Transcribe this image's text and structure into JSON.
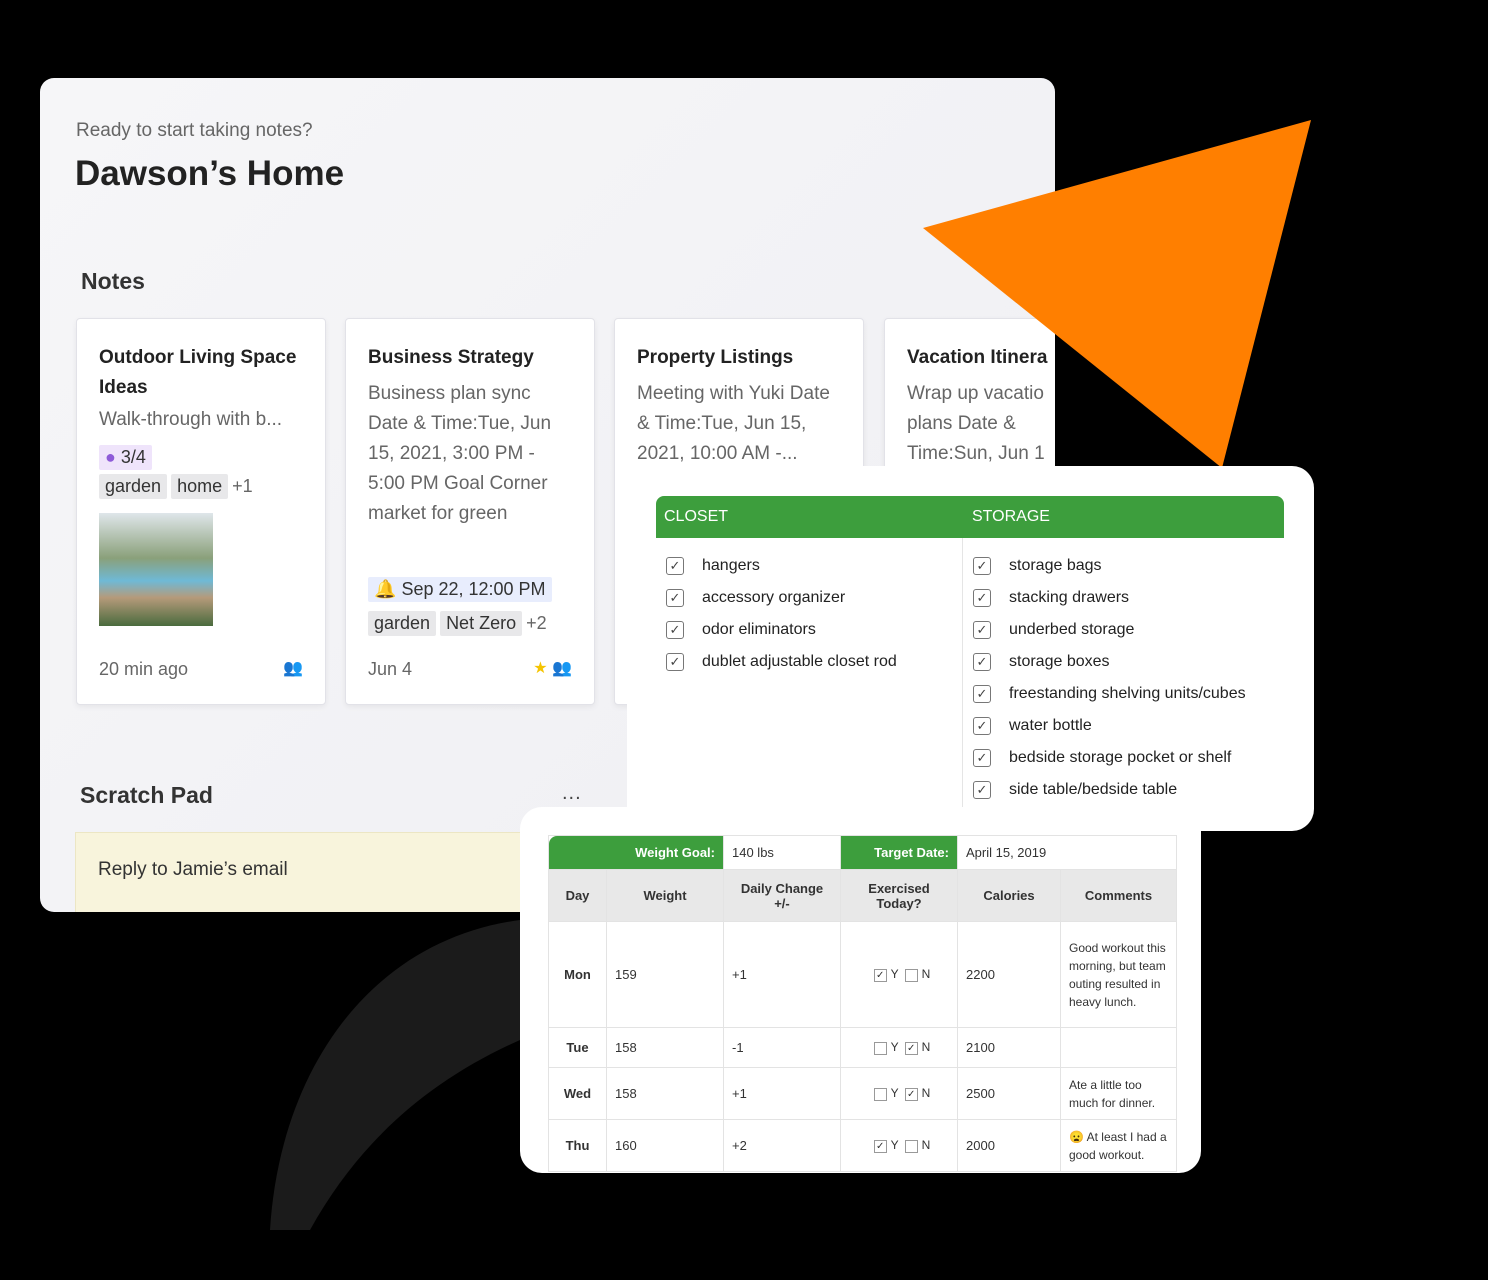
{
  "header": {
    "subtitle": "Ready to start taking notes?",
    "title": "Dawson’s Home"
  },
  "notes": {
    "heading": "Notes",
    "cards": [
      {
        "title": "Outdoor Living Space Ideas",
        "body": "Walk-through with b...",
        "task_progress": "3/4",
        "tags": [
          "garden",
          "home"
        ],
        "more_tags": "+1",
        "footer": "20 min ago"
      },
      {
        "title": "Business Strategy",
        "body": "Business plan sync Date & Time:Tue, Jun 15, 2021, 3:00 PM - 5:00 PM Goal Corner market for green",
        "reminder": "Sep 22, 12:00 PM",
        "tags": [
          "garden",
          "Net Zero"
        ],
        "more_tags": "+2",
        "footer": "Jun 4"
      },
      {
        "title": "Property Listings",
        "body": "Meeting with Yuki Date & Time:Tue, Jun 15, 2021, 10:00 AM -..."
      },
      {
        "title": "Vacation Itinera",
        "body": "Wrap up vacatio plans Date & Time:Sun, Jun 1"
      }
    ]
  },
  "scratch": {
    "heading": "Scratch Pad",
    "menu": "...",
    "text": "Reply to Jamie’s email"
  },
  "checklist": {
    "columns": [
      {
        "title": "CLOSET",
        "items": [
          "hangers",
          "accessory organizer",
          "odor eliminators",
          "dublet adjustable closet rod"
        ]
      },
      {
        "title": "STORAGE",
        "items": [
          "storage bags",
          "stacking drawers",
          "underbed storage",
          "storage boxes",
          "freestanding shelving units/cubes",
          "water bottle",
          "bedside storage pocket or shelf",
          "side table/bedside table"
        ]
      }
    ]
  },
  "tracker": {
    "goal_label": "Weight Goal:",
    "goal_value": "140 lbs",
    "date_label": "Target Date:",
    "date_value": "April 15, 2019",
    "headers": [
      "Day",
      "Weight",
      "Daily Change +/-",
      "Exercised Today?",
      "Calories",
      "Comments"
    ],
    "yes": "Y",
    "no": "N",
    "rows": [
      {
        "day": "Mon",
        "weight": "159",
        "change": "+1",
        "exercised": true,
        "calories": "2200",
        "comment": "Good workout this morning, but team outing resulted in heavy lunch."
      },
      {
        "day": "Tue",
        "weight": "158",
        "change": "-1",
        "exercised": false,
        "calories": "2100",
        "comment": ""
      },
      {
        "day": "Wed",
        "weight": "158",
        "change": "+1",
        "exercised": false,
        "calories": "2500",
        "comment": "Ate a little too much for dinner."
      },
      {
        "day": "Thu",
        "weight": "160",
        "change": "+2",
        "exercised": true,
        "calories": "2000",
        "comment": "😦 At least I had a good workout."
      }
    ]
  },
  "colors": {
    "accent_green": "#3d9e3d",
    "orange": "#ff7f00",
    "purple": "#8e5bd8"
  }
}
